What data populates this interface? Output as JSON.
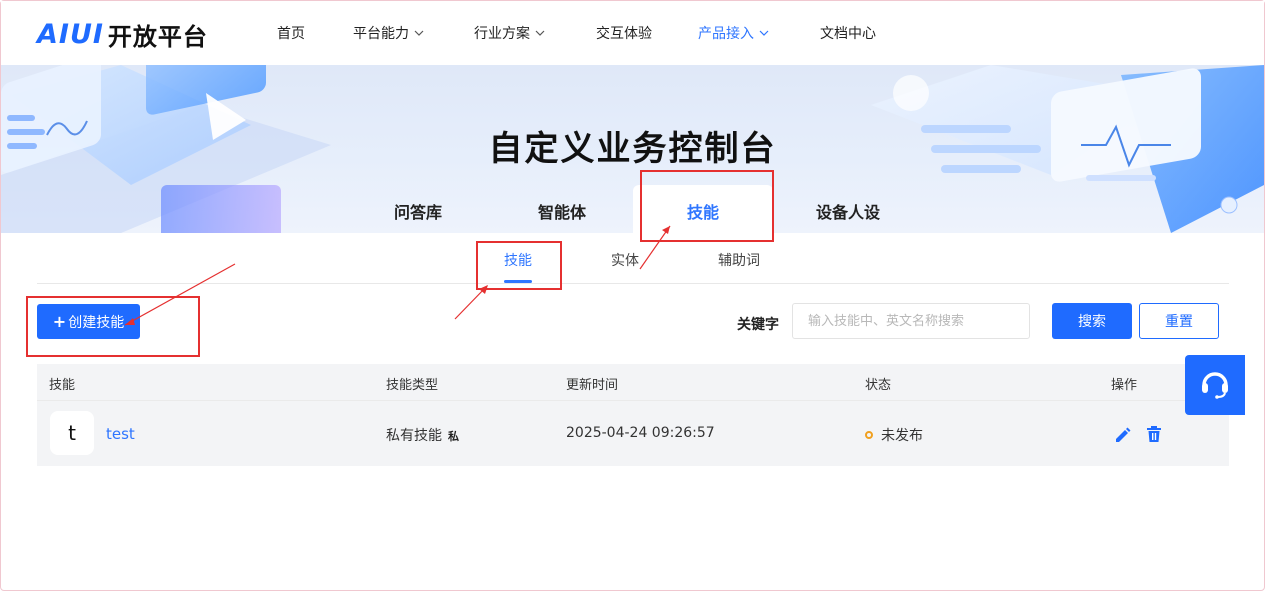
{
  "brand": {
    "mark": "AIUI",
    "name": "开放平台"
  },
  "nav": {
    "items": [
      {
        "label": "首页",
        "dropdown": false,
        "active": false
      },
      {
        "label": "平台能力",
        "dropdown": true,
        "active": false
      },
      {
        "label": "行业方案",
        "dropdown": true,
        "active": false
      },
      {
        "label": "交互体验",
        "dropdown": false,
        "active": false
      },
      {
        "label": "产品接入",
        "dropdown": true,
        "active": true
      },
      {
        "label": "文档中心",
        "dropdown": false,
        "active": false
      }
    ]
  },
  "banner": {
    "title": "自定义业务控制台",
    "tabs": [
      {
        "label": "问答库",
        "active": false
      },
      {
        "label": "智能体",
        "active": false
      },
      {
        "label": "技能",
        "active": true
      },
      {
        "label": "设备人设",
        "active": false
      }
    ]
  },
  "subtabs": [
    {
      "label": "技能",
      "active": true
    },
    {
      "label": "实体",
      "active": false
    },
    {
      "label": "辅助词",
      "active": false
    }
  ],
  "toolbar": {
    "create_plus": "+",
    "create_label": "创建技能",
    "keyword_label": "关键字",
    "search_placeholder": "输入技能中、英文名称搜索",
    "search_value": "",
    "search_label": "搜索",
    "reset_label": "重置"
  },
  "table": {
    "columns": [
      "技能",
      "技能类型",
      "更新时间",
      "状态",
      "操作"
    ],
    "rows": [
      {
        "avatar": "t",
        "name": "test",
        "type": "私有技能",
        "type_badge": "私",
        "updated": "2025-04-24 09:26:57",
        "status": "未发布"
      }
    ]
  },
  "icons": {
    "edit": "pencil-icon",
    "delete": "trash-icon",
    "support": "headset-icon",
    "dropdown": "chevron-down-icon"
  },
  "colors": {
    "primary": "#1f6bff",
    "active_text": "#2f76ff",
    "status_unpublished": "#f0a020",
    "annotation": "#e53030"
  }
}
